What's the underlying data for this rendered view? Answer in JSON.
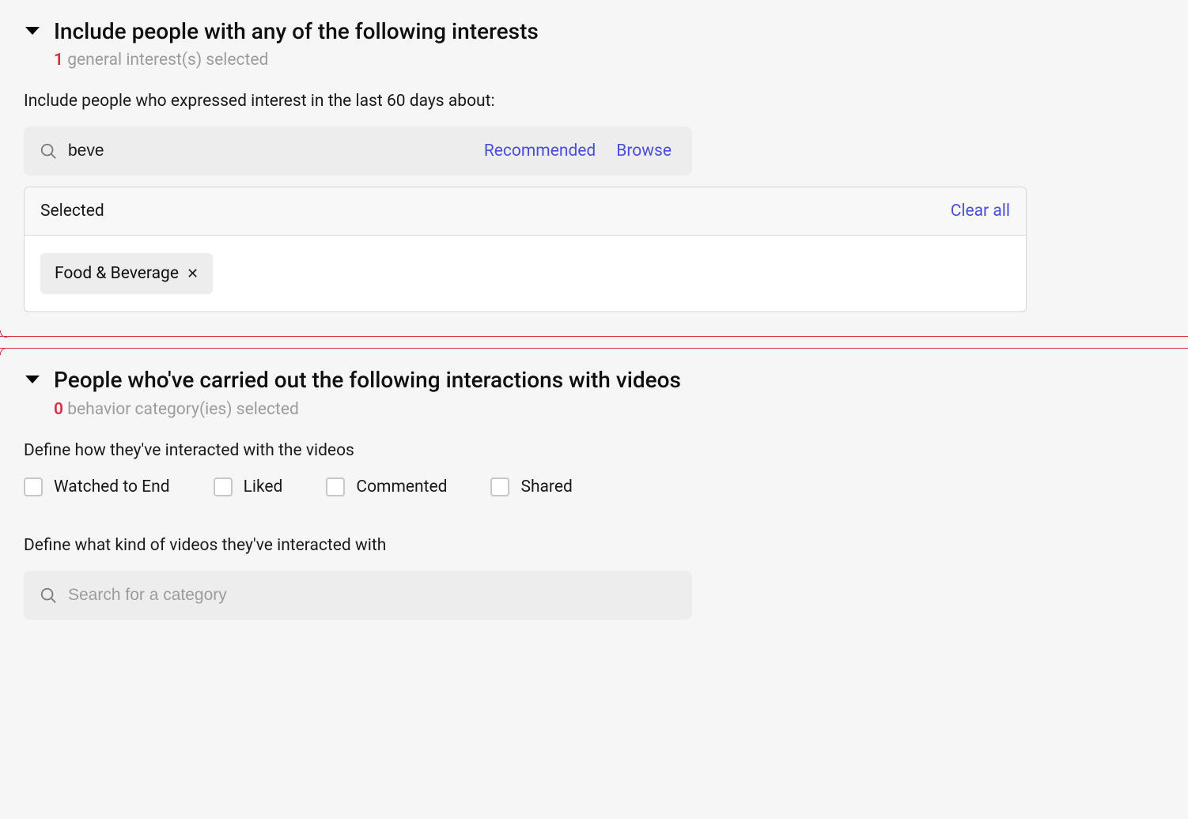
{
  "interests": {
    "title": "Include people with any of the following interests",
    "count": "1",
    "count_suffix": " general interest(s) selected",
    "description": "Include people who expressed interest in the last 60 days about:",
    "search_value": "beve",
    "recommended_label": "Recommended",
    "browse_label": "Browse",
    "selected_header": "Selected",
    "clear_all_label": "Clear all",
    "chips": [
      {
        "label": "Food & Beverage"
      }
    ]
  },
  "behaviors": {
    "title": "People who've carried out the following interactions with videos",
    "count": "0",
    "count_suffix": " behavior category(ies) selected",
    "interact_description": "Define how they've interacted with the videos",
    "checkboxes": [
      {
        "label": "Watched to End"
      },
      {
        "label": "Liked"
      },
      {
        "label": "Commented"
      },
      {
        "label": "Shared"
      }
    ],
    "category_description": "Define what kind of videos they've interacted with",
    "search_placeholder": "Search for a category"
  }
}
